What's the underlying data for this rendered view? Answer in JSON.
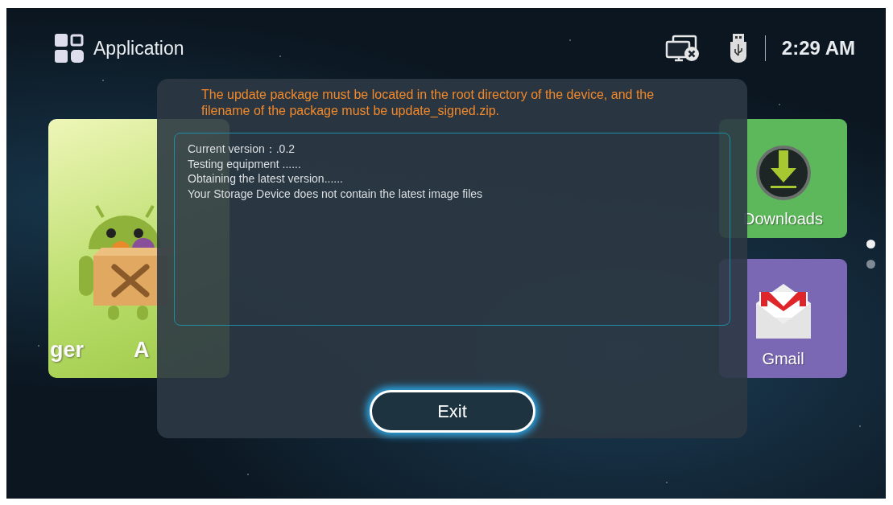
{
  "header": {
    "title": "Application",
    "time": "2:29 AM"
  },
  "feature_tile": {
    "labels": [
      "ger",
      "A"
    ]
  },
  "side_tiles": [
    {
      "kind": "downloads",
      "label": "Downloads",
      "color": "#5cb85a"
    },
    {
      "kind": "mail",
      "label": "Gmail",
      "color": "#7b68b4"
    }
  ],
  "pages": [
    {
      "selected": true
    },
    {
      "selected": false
    }
  ],
  "dialog": {
    "message": "The update package must be located in the root directory of the device, and the filename of the package must be update_signed.zip.",
    "log": [
      "Current version：.0.2",
      "Testing equipment ......",
      "Obtaining the latest version......",
      "Your Storage Device does not contain the latest image files"
    ],
    "button": "Exit"
  }
}
